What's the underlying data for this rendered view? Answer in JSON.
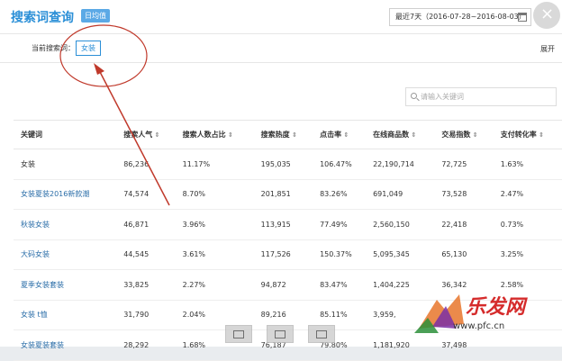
{
  "header": {
    "title": "搜索词查询",
    "tag": "日均值",
    "date_range": "最近7天（2016-07-28~2016-08-03）",
    "close_label": "×"
  },
  "filter": {
    "label": "当前搜索词：",
    "chip": "女装",
    "expand": "展开"
  },
  "search": {
    "placeholder": "请输入关键词"
  },
  "table": {
    "columns": [
      "关键词",
      "搜索人气",
      "搜索人数占比",
      "搜索热度",
      "点击率",
      "在线商品数",
      "交易指数",
      "支付转化率"
    ],
    "sortable": [
      false,
      true,
      true,
      true,
      true,
      true,
      true,
      true
    ],
    "rows": [
      [
        "女装",
        "86,236",
        "11.17%",
        "195,035",
        "106.47%",
        "22,190,714",
        "72,725",
        "1.63%"
      ],
      [
        "女装夏装2016新款潮",
        "74,574",
        "8.70%",
        "201,851",
        "83.26%",
        "691,049",
        "73,528",
        "2.47%"
      ],
      [
        "秋装女装",
        "46,871",
        "3.96%",
        "113,915",
        "77.49%",
        "2,560,150",
        "22,418",
        "0.73%"
      ],
      [
        "大码女装",
        "44,545",
        "3.61%",
        "117,526",
        "150.37%",
        "5,095,345",
        "65,130",
        "3.25%"
      ],
      [
        "夏季女装套装",
        "33,825",
        "2.27%",
        "94,872",
        "83.47%",
        "1,404,225",
        "36,342",
        "2.58%"
      ],
      [
        "女装 t恤",
        "31,790",
        "2.04%",
        "89,216",
        "85.11%",
        "3,959,",
        "",
        ""
      ],
      [
        "女装夏装套装",
        "28,292",
        "1.68%",
        "76,187",
        "79.80%",
        "1,181,920",
        "37,498",
        ""
      ]
    ]
  },
  "watermark": {
    "text": "乐发网",
    "url": "www.pfc.cn"
  },
  "colors": {
    "accent": "#2b8fd7",
    "annotation": "#c0392b"
  }
}
